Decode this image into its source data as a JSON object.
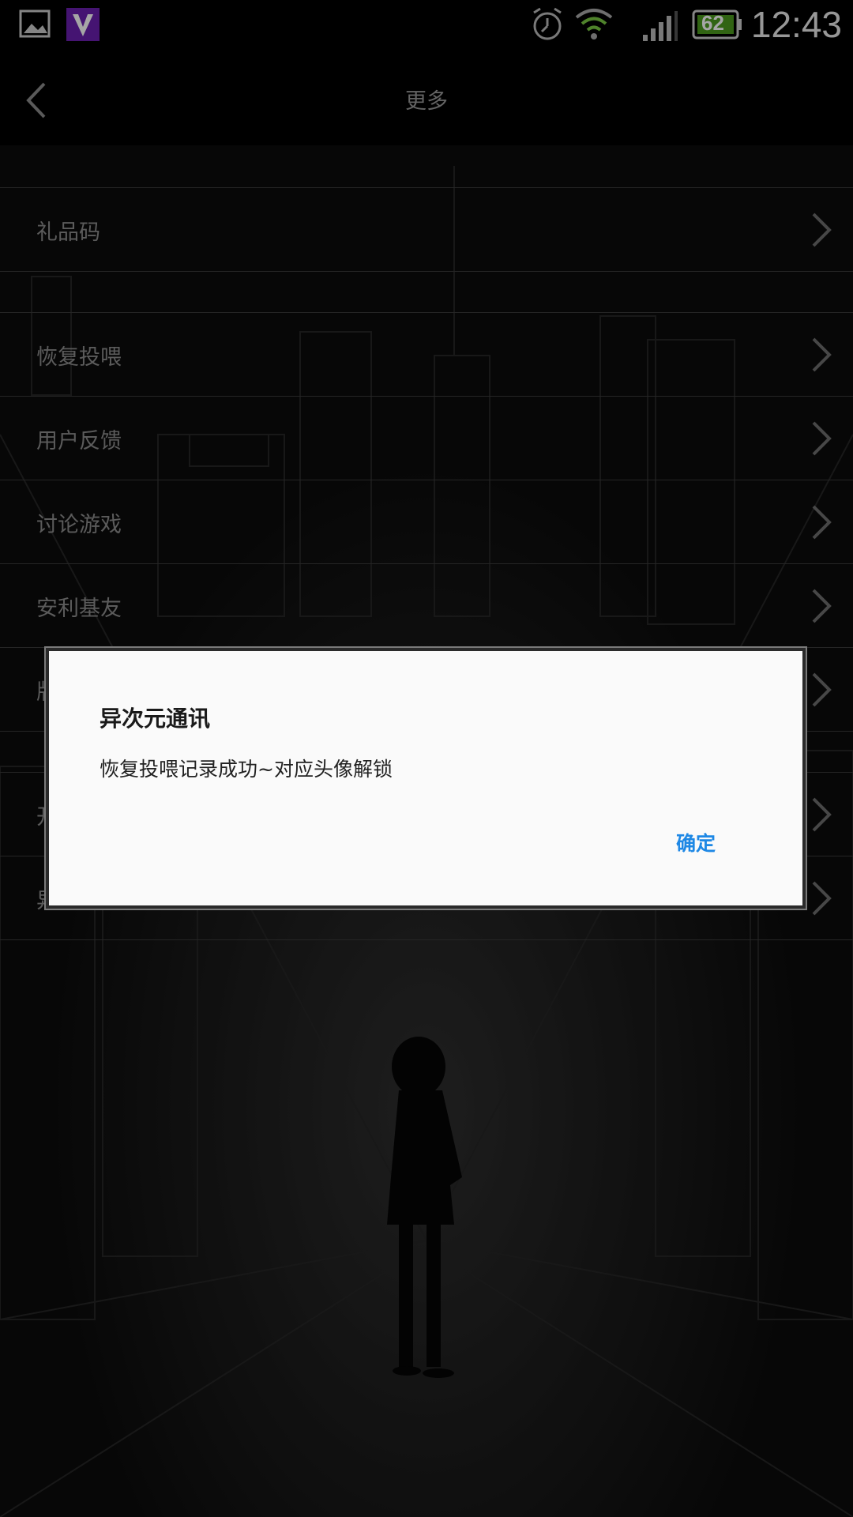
{
  "status_bar": {
    "time": "12:43",
    "battery": "62",
    "icons": [
      "gallery-icon",
      "vine-icon",
      "alarm-icon",
      "wifi-icon",
      "signal-icon",
      "battery-icon"
    ]
  },
  "header": {
    "title": "更多",
    "back_icon": "chevron-left-icon"
  },
  "menu": {
    "items": [
      {
        "label": "礼品码"
      },
      {
        "label": "恢复投喂"
      },
      {
        "label": "用户反馈"
      },
      {
        "label": "讨论游戏"
      },
      {
        "label": "安利基友"
      },
      {
        "label": "版"
      },
      {
        "label": "开"
      },
      {
        "label": "异"
      }
    ]
  },
  "dialog": {
    "title": "异次元通讯",
    "message": "恢复投喂记录成功~对应头像解锁",
    "ok_label": "确定"
  },
  "colors": {
    "accent": "#1e88e5",
    "background": "#0b0b0b"
  }
}
